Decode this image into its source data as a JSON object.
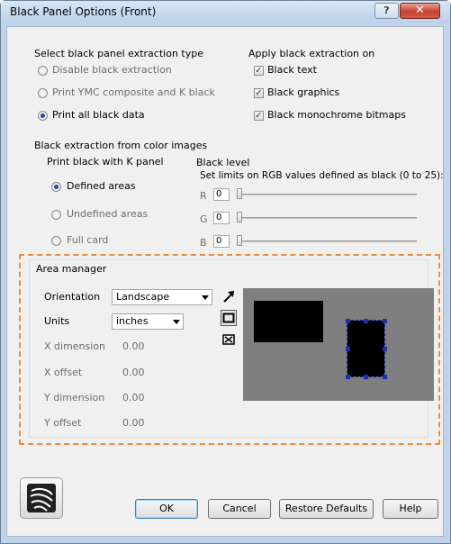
{
  "window": {
    "title": "Black Panel Options (Front)",
    "help_glyph": "?",
    "close_glyph": "✕"
  },
  "extraction_type": {
    "heading": "Select black panel extraction type",
    "options": [
      {
        "label": "Disable black extraction",
        "selected": false
      },
      {
        "label": "Print YMC composite and K black",
        "selected": false
      },
      {
        "label": "Print all black data",
        "selected": true
      }
    ]
  },
  "apply_on": {
    "heading": "Apply black extraction on",
    "options": [
      {
        "label": "Black text",
        "checked": true
      },
      {
        "label": "Black graphics",
        "checked": true
      },
      {
        "label": "Black monochrome bitmaps",
        "checked": true
      }
    ]
  },
  "color_images": {
    "heading": "Black extraction from color images",
    "print_k_heading": "Print black with K panel",
    "areas": [
      {
        "label": "Defined areas",
        "selected": true
      },
      {
        "label": "Undefined areas",
        "selected": false
      },
      {
        "label": "Full card",
        "selected": false
      }
    ],
    "black_level_heading": "Black level",
    "black_level_desc": "Set limits on RGB values defined as black (0 to 25):",
    "channels": [
      {
        "label": "R",
        "value": "0"
      },
      {
        "label": "G",
        "value": "0"
      },
      {
        "label": "B",
        "value": "0"
      }
    ]
  },
  "area_manager": {
    "heading": "Area manager",
    "orientation_label": "Orientation",
    "orientation_value": "Landscape",
    "units_label": "Units",
    "units_value": "inches",
    "fields": [
      {
        "label": "X dimension",
        "value": "0.00"
      },
      {
        "label": "X offset",
        "value": "0.00"
      },
      {
        "label": "Y dimension",
        "value": "0.00"
      },
      {
        "label": "Y offset",
        "value": "0.00"
      }
    ],
    "tools": [
      "select-arrow-icon",
      "draw-rectangle-icon",
      "delete-area-icon"
    ]
  },
  "buttons": {
    "ok": "OK",
    "cancel": "Cancel",
    "restore": "Restore Defaults",
    "help": "Help"
  },
  "logo_icon": "zebra-logo-icon",
  "colors": {
    "accent_dash": "#f08a3c",
    "preview_bg": "#7f7f7f",
    "handle": "#1f2fb0"
  }
}
